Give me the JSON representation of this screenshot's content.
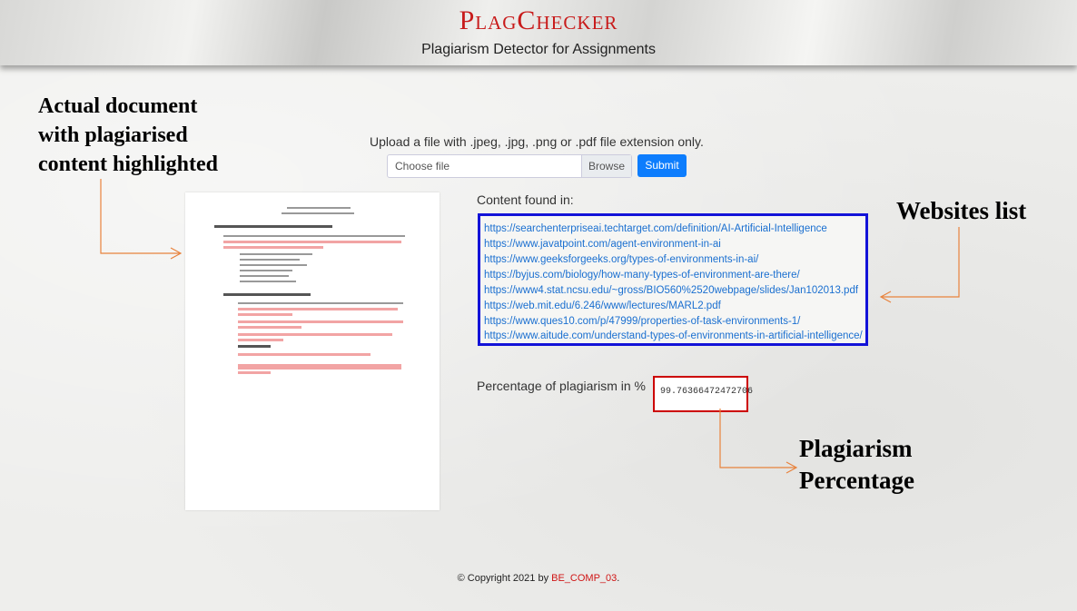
{
  "header": {
    "brand": "PlagChecker",
    "tagline": "Plagiarism Detector for Assignments"
  },
  "annotations": {
    "document": [
      "Actual document",
      "with plagiarised",
      "content highlighted"
    ],
    "websites": "Websites list",
    "percentage": [
      "Plagiarism",
      "Percentage"
    ]
  },
  "upload": {
    "instruction": "Upload a file with .jpeg, .jpg, .png or .pdf file extension only.",
    "placeholder": "Choose file",
    "browse_label": "Browse",
    "submit_label": "Submit"
  },
  "results": {
    "content_found_label": "Content found in:",
    "websites": [
      "https://searchenterpriseai.techtarget.com/definition/AI-Artificial-Intelligence",
      "https://www.javatpoint.com/agent-environment-in-ai",
      "https://www.geeksforgeeks.org/types-of-environments-in-ai/",
      "https://byjus.com/biology/how-many-types-of-environment-are-there/",
      "https://www4.stat.ncsu.edu/~gross/BIO560%2520webpage/slides/Jan102013.pdf",
      "https://web.mit.edu/6.246/www/lectures/MARL2.pdf",
      "https://www.ques10.com/p/47999/properties-of-task-environments-1/",
      "https://www.aitude.com/understand-types-of-environments-in-artificial-intelligence/"
    ],
    "percentage_label": "Percentage of plagiarism in %",
    "percentage_value": "99.76366472472706"
  },
  "footer": {
    "copyright": "© Copyright 2021 by ",
    "team": "BE_COMP_03",
    "period": "."
  },
  "colors": {
    "brand": "#c81b1b",
    "submit": "#0d7dfd",
    "websites_border": "#1313d8",
    "percentage_border": "#cc0000",
    "arrow": "#e8823c"
  }
}
